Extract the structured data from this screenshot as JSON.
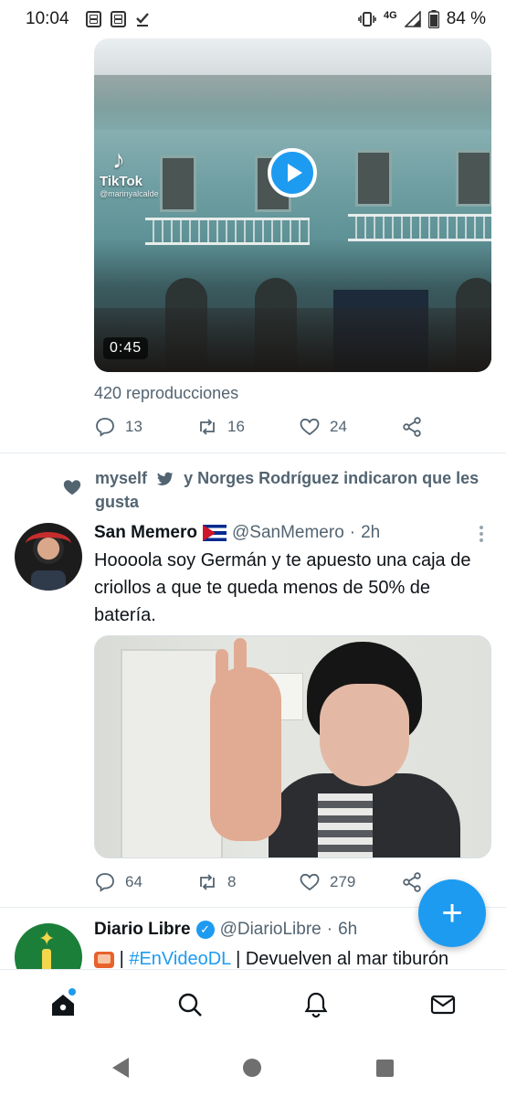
{
  "status_bar": {
    "time": "10:04",
    "network": "4G",
    "battery": "84 %"
  },
  "tweet1": {
    "video_duration": "0:45",
    "tiktok_brand": "TikTok",
    "tiktok_user": "@marinyalcalde",
    "views": "420 reproducciones",
    "actions": {
      "replies": "13",
      "retweets": "16",
      "likes": "24"
    }
  },
  "tweet2": {
    "social_context": {
      "user1": "myself",
      "rest": "y Norges Rodríguez indicaron que les gusta"
    },
    "name": "San Memero",
    "handle": "@SanMemero",
    "separator": "·",
    "time": "2h",
    "text": "Hoooola soy Germán y te apuesto una caja de criollos a que te queda menos de 50% de batería.",
    "actions": {
      "replies": "64",
      "retweets": "8",
      "likes": "279"
    }
  },
  "tweet3": {
    "name": "Diario Libre",
    "handle": "@DiarioLibre",
    "separator": "·",
    "time": "6h",
    "text_sep": "|",
    "hashtag": "#EnVideoDL",
    "text_rest": "| Devuelven al mar tiburón"
  },
  "fab": {
    "label": "+"
  },
  "colors": {
    "accent": "#1d9bf0",
    "muted_text": "#536471",
    "primary_text": "#0f1419"
  },
  "icons": {
    "nav": [
      "home-icon",
      "search-icon",
      "bell-icon",
      "mail-icon"
    ],
    "actions": [
      "reply-icon",
      "retweet-icon",
      "like-icon",
      "share-icon"
    ]
  }
}
